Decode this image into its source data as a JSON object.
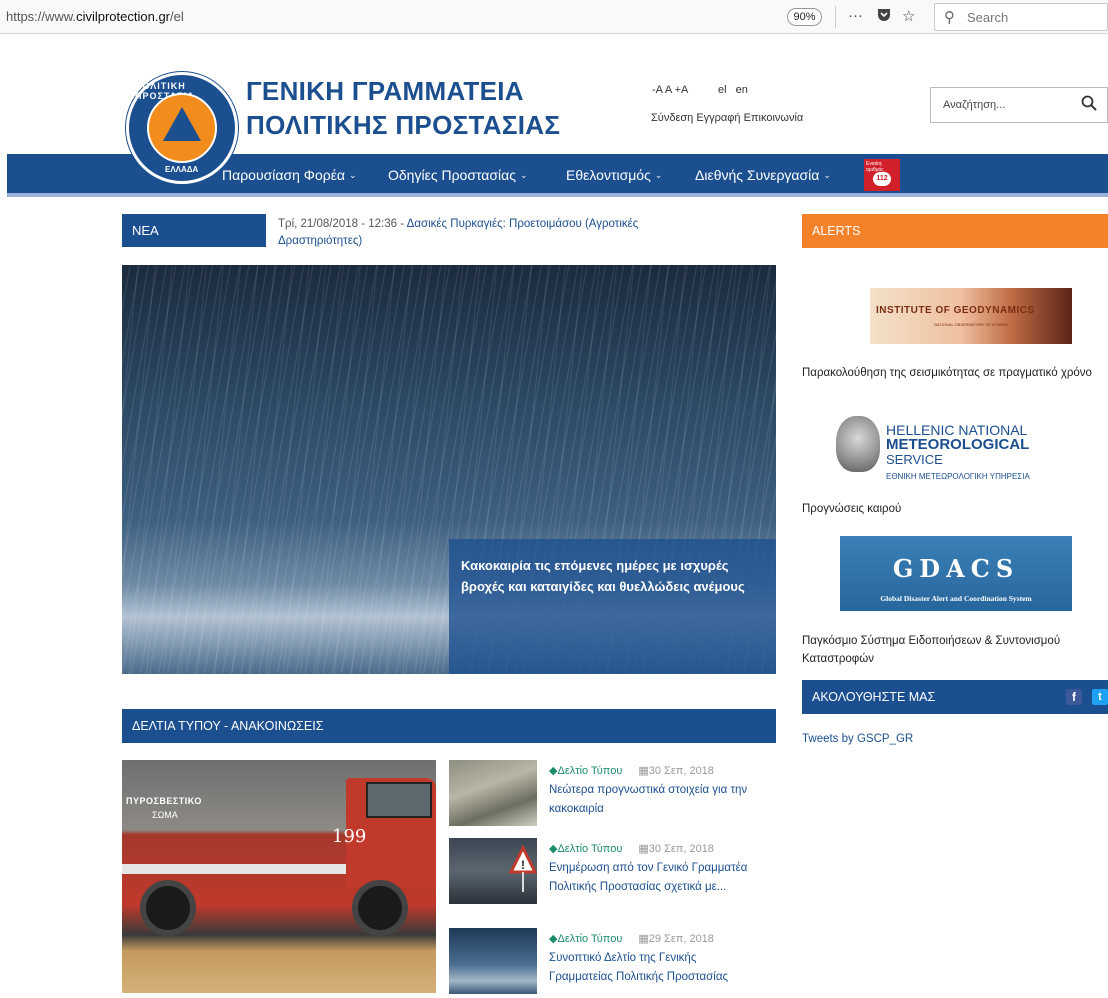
{
  "browser": {
    "url_prefix": "https://www.",
    "url_domain": "civilprotection.gr",
    "url_path": "/el",
    "zoom": "90%",
    "search_placeholder": "Search"
  },
  "header": {
    "logo_top": "ΠΟΛΙΤΙΚΗ ΠΡΟΣΤΑΣΙΑ",
    "logo_bottom": "ΕΛΛΑΔΑ",
    "title_line1": "ΓΕΝΙΚΗ ΓΡΑΜΜΑΤΕΙΑ",
    "title_line2": "ΠΟΛΙΤΙΚΗΣ ΠΡΟΣΤΑΣΙΑΣ",
    "font_controls": "-A A +A",
    "lang_el": "el",
    "lang_en": "en",
    "login": "Σύνδεση",
    "register": "Εγγραφή",
    "contact": "Επικοινωνία",
    "search_placeholder": "Αναζήτηση..."
  },
  "nav": {
    "items": [
      "Παρουσίαση Φορέα",
      "Οδηγίες Προστασίας",
      "Εθελοντισμός",
      "Διεθνής Συνεργασία"
    ],
    "badge_small": "Ενιαίος αριθμός",
    "badge_num": "112"
  },
  "ticker": {
    "label": "ΝΕΑ",
    "date": "Τρί, 21/08/2018 - 12:36",
    "sep": " - ",
    "title": "Δασικές Πυρκαγιές: Προετοιμάσου (Αγροτικές Δραστηριότητες)"
  },
  "slider": {
    "caption": "Κακοκαιρία τις επόμενες ημέρες με ισχυρές βροχές και καταιγίδες και θυελλώδεις ανέμους",
    "dot_count": 5,
    "active_index": 3
  },
  "press": {
    "header": "ΔΕΛΤΙΑ ΤΥΠΟΥ - ΑΝΑΚΟΙΝΩΣΕΙΣ",
    "truck_text1": "ΠΥΡΟΣΒΕΣΤΙΚΟ",
    "truck_text2": "ΣΩΜΑ",
    "truck_number": "199",
    "items": [
      {
        "category": "Δελτίο Τύπου",
        "date": "30 Σεπ, 2018",
        "title": "Νεώτερα προγνωστικά στοιχεία για την κακοκαιρία"
      },
      {
        "category": "Δελτίο Τύπου",
        "date": "30 Σεπ, 2018",
        "title": "Ενημέρωση από τον Γενικό Γραμματέα Πολιτικής Προστασίας σχετικά με..."
      },
      {
        "category": "Δελτίο Τύπου",
        "date": "29 Σεπ, 2018",
        "title": "Συνοπτικό Δελτίο της Γενικής Γραμματείας Πολιτικής Προστασίας"
      }
    ]
  },
  "sidebar": {
    "alerts": "ALERTS",
    "inst_title": "INSTITUTE OF GEODYNAMICS",
    "inst_sub": "NATIONAL OBSERVATORY OF ATHENS",
    "seismic_text": "Παρακολούθηση της σεισμικότητας σε πραγματικό χρόνο",
    "hnms_l1": "HELLENIC NATIONAL",
    "hnms_l2": "METEOROLOGICAL",
    "hnms_l3": "SERVICE",
    "hnms_l4": "ΕΘΝΙΚΗ ΜΕΤΕΩΡΟΛΟΓΙΚΗ ΥΠΗΡΕΣΙΑ",
    "forecast_text": "Προγνώσεις καιρού",
    "gdacs_title": "GDACS",
    "gdacs_sub": "Global Disaster Alert and Coordination System",
    "gdacs_text": "Παγκόσμιο Σύστημα Ειδοποιήσεων & Συντονισμού Καταστροφών",
    "follow": "ΑΚΟΛΟΥΘΗΣΤΕ ΜΑΣ",
    "tweets": "Tweets by GSCP_GR"
  }
}
